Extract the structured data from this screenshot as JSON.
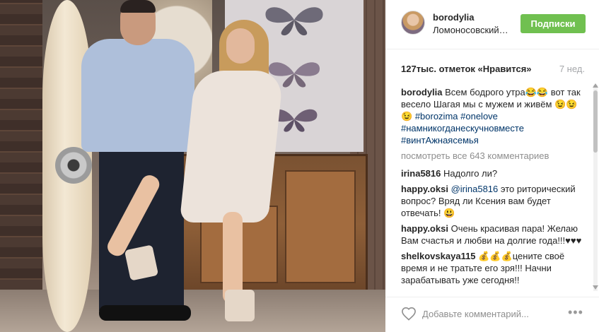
{
  "post": {
    "username": "borodylia",
    "location": "Ломоносовский…",
    "follow_label": "Подписки",
    "likes_text": "127тыс. отметок «Нравится»",
    "age": "7 нед."
  },
  "caption": {
    "user": "borodylia",
    "text": "Всем бодрого утра😂😂 вот так весело Шагая мы с мужем и живём 😉😉😉",
    "tags": [
      "#borozima",
      "#onelove",
      "#намникогданескучновместе",
      "#винтАжнаясемья"
    ]
  },
  "view_all_label": "посмотреть все 643 комментариев",
  "comments": [
    {
      "user": "irina5816",
      "text": "Надолго ли?"
    },
    {
      "user": "happy.oksi",
      "mention": "@irina5816",
      "text": "это риторический вопрос? Вряд ли Ксения вам будет отвечать! 😃"
    },
    {
      "user": "happy.oksi",
      "text": "Очень красивая пара! Желаю Вам счастья и любви на долгие года!!!♥♥♥"
    },
    {
      "user": "shelkovskaya115",
      "text": "💰💰💰цените своё время и не тратьте его зря!!! Начни зарабатывать уже сегодня!!"
    }
  ],
  "footer": {
    "comment_placeholder": "Добавьте комментарий...",
    "more_label": "•••"
  },
  "colors": {
    "follow": "#70c050",
    "hashtag": "#003569",
    "muted": "#8e8e8e"
  },
  "icons": {
    "like": "heart-outline-icon",
    "more": "ellipsis-icon"
  }
}
